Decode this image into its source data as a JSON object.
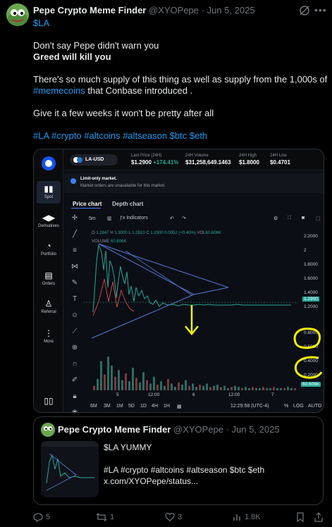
{
  "post": {
    "author_name": "Pepe Crypto Meme Finder",
    "handle": "@XYOPepe",
    "separator": "·",
    "date": "Jun 5, 2025",
    "ticker": "$LA",
    "line1": "Don't say Pepe didn't warn you",
    "line2": "Greed will kill you",
    "line3_a": "There's so much supply of this thing as well as supply from the 1,000s of",
    "line4_link": "#memecoins",
    "line4_rest": " that Conbase introduced .",
    "line5": " Give it a few weeks it won't be pretty after all",
    "hashtags": "#LA #crypto #altcoins #altseason $btc $eth"
  },
  "exchange": {
    "pair": "LA-USD",
    "stats": [
      {
        "label": "Last Price (24H)",
        "value": "$1.2900",
        "change": "+174.41%"
      },
      {
        "label": "24H Volume",
        "value": "$31,258,649.1463"
      },
      {
        "label": "24H High",
        "value": "$1.8000"
      },
      {
        "label": "24H Low",
        "value": "$0.4701"
      }
    ],
    "sidebar": [
      "Spot",
      "Derivatives",
      "Portfolio",
      "Orders",
      "Referral",
      "More"
    ],
    "notice_title": "Limit-only market.",
    "notice_body": "Market orders are unavailable for this market.",
    "tabs": [
      "Price chart",
      "Depth chart"
    ],
    "interval": "5m",
    "indicators": "Indicators",
    "ohlc": {
      "o": "1.2847",
      "h": "1.3000",
      "l": "1.2810",
      "c": "1.2900",
      "chg": "0.0052 (+0.40%)",
      "vol": "60.606K"
    },
    "volume_label": "VOLUME",
    "volume_value": "60.606K",
    "y_ticks": [
      "2.2000",
      "2",
      "1.8000",
      "1.6000",
      "1.4000",
      "1.2000",
      "0.8000",
      "0.6000",
      "0.4000",
      "0.2000"
    ],
    "price_tag": "1.2900",
    "vol_tag": "60.606K",
    "x_ticks": [
      "5",
      "12:00",
      "6",
      "12:00",
      "7"
    ],
    "timeframes": [
      "6M",
      "3M",
      "1M",
      "5D",
      "1D",
      "4H",
      "1H"
    ],
    "clock": "12:29:58 (UTC-4)",
    "scale_opts": [
      "%",
      "LOG",
      "AUTO"
    ],
    "colors": {
      "up": "#26a69a",
      "down": "#ef5350",
      "pattern": "#4f7bd8",
      "annotation": "#f5f500"
    }
  },
  "quote": {
    "author_name": "Pepe Crypto Meme Finder",
    "handle": "@XYOPepe",
    "date": "Jun 5, 2025",
    "line1": "$LA YUMMY",
    "line2": "#LA #crypto #altcoins #altseason $btc $eth",
    "line3": "x.com/XYOPepe/status..."
  },
  "actions": {
    "replies": "5",
    "reposts": "1",
    "likes": "3",
    "views": "1.8K"
  }
}
